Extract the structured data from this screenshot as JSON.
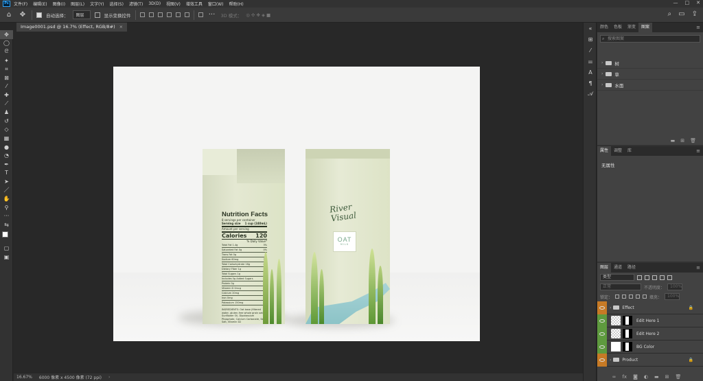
{
  "app": {
    "logo": "Ps"
  },
  "menu": [
    "文件(F)",
    "编辑(E)",
    "图像(I)",
    "图层(L)",
    "文字(Y)",
    "选择(S)",
    "滤镜(T)",
    "3D(D)",
    "视图(V)",
    "增效工具",
    "窗口(W)",
    "帮助(H)"
  ],
  "window_controls": {
    "minimize": "—",
    "maximize": "□",
    "close": "✕"
  },
  "options": {
    "auto_select_label": "自动选择：",
    "auto_select_value": "图层",
    "transform_label": "显示变换控件",
    "mode_3d_label": "3D 模式："
  },
  "document_tab": {
    "title": "Image0001.psd @ 16.7% (Effect, RGB/8#)",
    "close": "×"
  },
  "status": {
    "zoom": "16.67%",
    "doc_size": "6000 像素 x 4500 像素 (72 ppi)",
    "arrow": "›"
  },
  "tools": [
    "move",
    "marquee",
    "lasso",
    "magic-wand",
    "crop",
    "frame",
    "eyedropper",
    "spot-heal",
    "brush",
    "stamp",
    "history-brush",
    "eraser",
    "gradient",
    "blur",
    "dodge",
    "pen",
    "type",
    "path-select",
    "line",
    "hand",
    "zoom",
    "more"
  ],
  "artwork": {
    "nutrition": {
      "title": "Nutrition Facts",
      "servings": "8 servings per container",
      "serving_size_label": "Serving size",
      "serving_size_value": "1 cup (240mL)",
      "amount_label": "Amount per serving",
      "calories_label": "Calories",
      "calories_value": "120",
      "dv_label": "% Daily Value*",
      "rows": [
        {
          "label": "Total Fat 1.4g",
          "value": "3%"
        },
        {
          "label": "Saturated Fat 0g",
          "value": "0%"
        },
        {
          "label": "Trans Fat 0g",
          "value": ""
        },
        {
          "label": "Sodium 60mg",
          "value": "3%"
        },
        {
          "label": "Total Carbohydrate 16g",
          "value": "6%"
        },
        {
          "label": "Dietary Fiber 1g",
          "value": "3%"
        },
        {
          "label": "Total Sugars 1g",
          "value": ""
        },
        {
          "label": "Includes 0g Added Sugars",
          "value": "0%"
        },
        {
          "label": "Protein 0g",
          "value": ""
        },
        {
          "label": "Vitamin D 0mcg",
          "value": "0%"
        },
        {
          "label": "Calcium 20mg",
          "value": "1%"
        },
        {
          "label": "Iron 0mg",
          "value": "0%"
        },
        {
          "label": "Potassium 150mg",
          "value": "2%"
        }
      ],
      "ingredients": "INGREDIENTS: Oat base (filtered water, gluten-free whole grain oats), Sunflower Oil, Dipotassium Phosphate, Calcium Carbonate, Sea Salt, Vitamin D2"
    },
    "brand": "River\nVisual",
    "oat_big": "OAT",
    "oat_small": "MILK"
  },
  "panels": {
    "top_tabs": [
      "颜色",
      "色板",
      "渐变",
      "图案"
    ],
    "top_active": "图案",
    "search_placeholder": "搜索图案",
    "groups": [
      "树",
      "草",
      "水面"
    ],
    "props_tabs": [
      "属性",
      "调整",
      "库"
    ],
    "props_text": "无属性",
    "layers_tabs": [
      "图层",
      "通道",
      "路径"
    ],
    "layer_kind": "类型",
    "blend_mode": "正常",
    "opacity_label": "不透明度：",
    "opacity_value": "100%",
    "lock_label": "锁定：",
    "fill_label": "填充：",
    "fill_value": "100%",
    "layers": [
      {
        "name": "Effect",
        "type": "group",
        "eye": "orange",
        "locked": true
      },
      {
        "name": "Edit Here 1",
        "type": "smart",
        "eye": "green",
        "locked": false
      },
      {
        "name": "Edit Here 2",
        "type": "smart",
        "eye": "green",
        "locked": false
      },
      {
        "name": "BG Color",
        "type": "fill",
        "eye": "green",
        "locked": false
      },
      {
        "name": "Product",
        "type": "group",
        "eye": "orange",
        "locked": true
      }
    ]
  }
}
